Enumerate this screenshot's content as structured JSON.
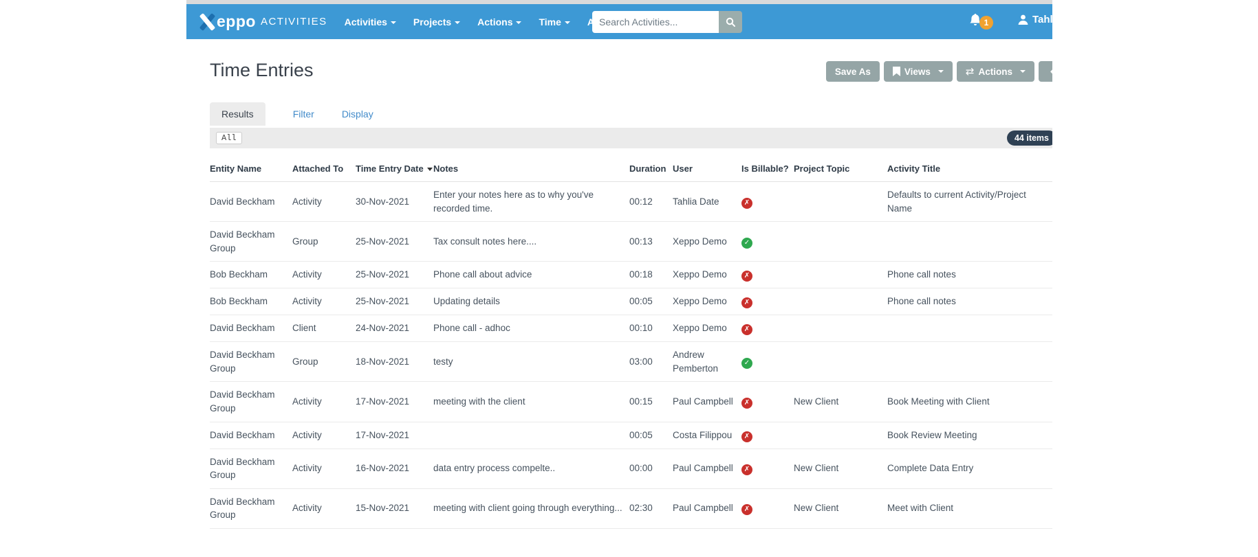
{
  "colors": {
    "navbar_blue": "#3d99d5",
    "brand_dark_blue": "#1d6fae",
    "button_gray": "#95a5a6",
    "notification_orange": "#f0a230",
    "count_badge_navy": "#2f4154",
    "link_blue": "#428bca",
    "billable_no_red": "#c9302c",
    "billable_yes_green": "#2fa84f"
  },
  "navbar": {
    "brand": {
      "name": "eppo",
      "suffix": "ACTIVITIES"
    },
    "menu": [
      {
        "label": "Activities"
      },
      {
        "label": "Projects"
      },
      {
        "label": "Actions"
      },
      {
        "label": "Time"
      },
      {
        "label": "Admin"
      }
    ],
    "search": {
      "placeholder": "Search Activities..."
    },
    "notifications": {
      "count": "1"
    },
    "user": {
      "name": "Tahlia"
    }
  },
  "page": {
    "title": "Time Entries",
    "toolbar": {
      "save_as_label": "Save As",
      "views_label": "Views",
      "actions_label": "Actions",
      "actions_glyph": "⇄",
      "collapse_glyph": "←"
    },
    "tabs": [
      {
        "label": "Results",
        "active": true
      },
      {
        "label": "Filter",
        "active": false
      },
      {
        "label": "Display",
        "active": false
      }
    ],
    "filter_bar": {
      "filter_label": "All",
      "items_count": "44 items"
    }
  },
  "table": {
    "columns": [
      "Entity Name",
      "Attached To",
      "Time Entry Date",
      "Notes",
      "Duration",
      "User",
      "Is Billable?",
      "Project Topic",
      "Activity Title"
    ],
    "sorted_column": "Time Entry Date",
    "sort_direction": "desc",
    "billable_glyphs": {
      "yes": "✓",
      "no": "✗"
    },
    "rows": [
      {
        "entity": "David Beckham",
        "attached_to": "Activity",
        "date": "30-Nov-2021",
        "notes": "Enter your notes here as to why you've recorded time.",
        "duration": "00:12",
        "user": "Tahlia Date",
        "billable": "no",
        "project_topic": "",
        "activity_title": "Defaults to current Activity/Project Name"
      },
      {
        "entity": "David Beckham Group",
        "attached_to": "Group",
        "date": "25-Nov-2021",
        "notes": "Tax consult notes here....",
        "duration": "00:13",
        "user": "Xeppo Demo",
        "billable": "yes",
        "project_topic": "",
        "activity_title": ""
      },
      {
        "entity": "Bob Beckham",
        "attached_to": "Activity",
        "date": "25-Nov-2021",
        "notes": "Phone call about advice",
        "duration": "00:18",
        "user": "Xeppo Demo",
        "billable": "no",
        "project_topic": "",
        "activity_title": "Phone call notes"
      },
      {
        "entity": "Bob Beckham",
        "attached_to": "Activity",
        "date": "25-Nov-2021",
        "notes": "Updating details",
        "duration": "00:05",
        "user": "Xeppo Demo",
        "billable": "no",
        "project_topic": "",
        "activity_title": "Phone call notes"
      },
      {
        "entity": "David Beckham",
        "attached_to": "Client",
        "date": "24-Nov-2021",
        "notes": "Phone call - adhoc",
        "duration": "00:10",
        "user": "Xeppo Demo",
        "billable": "no",
        "project_topic": "",
        "activity_title": ""
      },
      {
        "entity": "David Beckham Group",
        "attached_to": "Group",
        "date": "18-Nov-2021",
        "notes": "testy",
        "duration": "03:00",
        "user": "Andrew Pemberton",
        "billable": "yes",
        "project_topic": "",
        "activity_title": ""
      },
      {
        "entity": "David Beckham Group",
        "attached_to": "Activity",
        "date": "17-Nov-2021",
        "notes": "meeting with the client",
        "duration": "00:15",
        "user": "Paul Campbell",
        "billable": "no",
        "project_topic": "New Client",
        "activity_title": "Book Meeting with Client"
      },
      {
        "entity": "David Beckham",
        "attached_to": "Activity",
        "date": "17-Nov-2021",
        "notes": "",
        "duration": "00:05",
        "user": "Costa Filippou",
        "billable": "no",
        "project_topic": "",
        "activity_title": "Book Review Meeting"
      },
      {
        "entity": "David Beckham Group",
        "attached_to": "Activity",
        "date": "16-Nov-2021",
        "notes": "data entry process compelte..",
        "duration": "00:00",
        "user": "Paul Campbell",
        "billable": "no",
        "project_topic": "New Client",
        "activity_title": "Complete Data Entry"
      },
      {
        "entity": "David Beckham Group",
        "attached_to": "Activity",
        "date": "15-Nov-2021",
        "notes": "meeting with client going through everything...",
        "duration": "02:30",
        "user": "Paul Campbell",
        "billable": "no",
        "project_topic": "New Client",
        "activity_title": "Meet with Client"
      }
    ]
  }
}
